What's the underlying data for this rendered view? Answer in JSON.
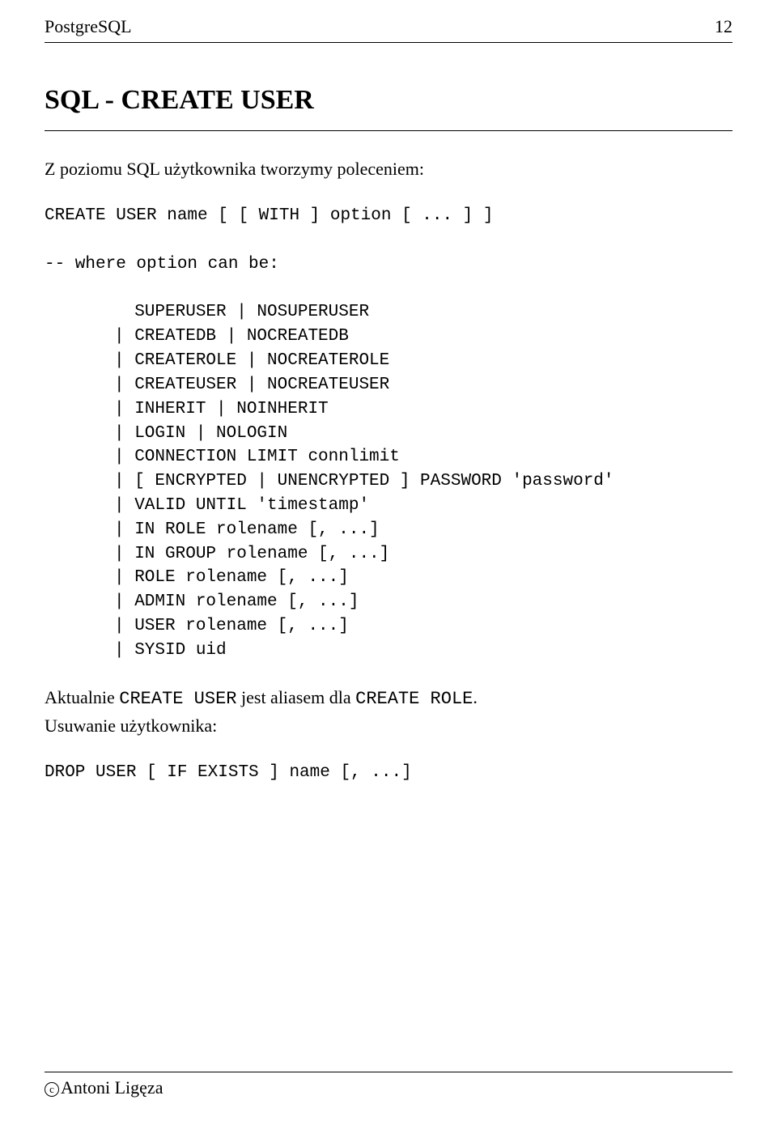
{
  "header": {
    "left": "PostgreSQL",
    "right": "12"
  },
  "title": "SQL - CREATE USER",
  "intro": "Z poziomu SQL użytkownika tworzymy poleceniem:",
  "code1_line1": "CREATE USER name [ [ WITH ] option [ ... ] ]",
  "code1_line2": "",
  "code1_line3": "-- where option can be:",
  "code2_line1": "  SUPERUSER | NOSUPERUSER",
  "code2_line2": "| CREATEDB | NOCREATEDB",
  "code2_line3": "| CREATEROLE | NOCREATEROLE",
  "code2_line4": "| CREATEUSER | NOCREATEUSER",
  "code2_line5": "| INHERIT | NOINHERIT",
  "code2_line6": "| LOGIN | NOLOGIN",
  "code2_line7": "| CONNECTION LIMIT connlimit",
  "code2_line8": "| [ ENCRYPTED | UNENCRYPTED ] PASSWORD 'password'",
  "code2_line9": "| VALID UNTIL 'timestamp'",
  "code2_line10": "| IN ROLE rolename [, ...]",
  "code2_line11": "| IN GROUP rolename [, ...]",
  "code2_line12": "| ROLE rolename [, ...]",
  "code2_line13": "| ADMIN rolename [, ...]",
  "code2_line14": "| USER rolename [, ...]",
  "code2_line15": "| SYSID uid",
  "note_prefix": "Aktualnie ",
  "note_mono1": "CREATE USER",
  "note_mid": " jest aliasem dla ",
  "note_mono2": "CREATE ROLE",
  "note_suffix": ".",
  "removal": "Usuwanie użytkownika:",
  "code3": "DROP USER [ IF EXISTS ] name [, ...]",
  "footer": {
    "copyright_symbol": "c",
    "author": "Antoni Ligęza"
  }
}
